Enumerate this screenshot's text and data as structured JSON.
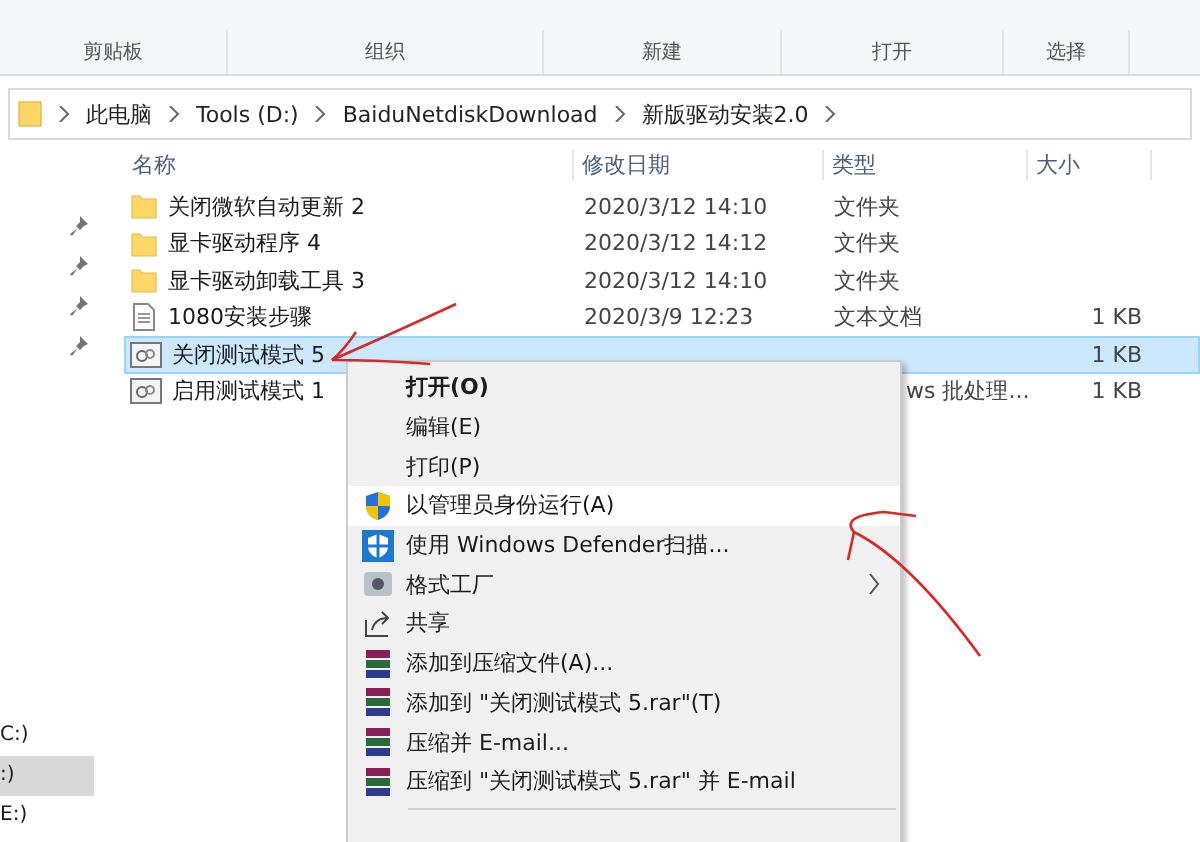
{
  "ribbon": {
    "groups": [
      "剪贴板",
      "组织",
      "新建",
      "打开",
      "选择"
    ]
  },
  "address_bar": {
    "crumbs": [
      "此电脑",
      "Tools (D:)",
      "BaiduNetdiskDownload",
      "新版驱动安装2.0"
    ]
  },
  "nav_pane": {
    "drives": [
      {
        "label": "C:)",
        "selected": false
      },
      {
        "label": ":)",
        "selected": true
      },
      {
        "label": "E:)",
        "selected": false
      }
    ]
  },
  "file_list": {
    "columns": [
      "名称",
      "修改日期",
      "类型",
      "大小"
    ],
    "rows": [
      {
        "kind": "folder",
        "name": "关闭微软自动更新 2",
        "date": "2020/3/12 14:10",
        "type": "文件夹",
        "selected": false
      },
      {
        "kind": "folder",
        "name": "显卡驱动程序 4",
        "date": "2020/3/12 14:12",
        "type": "文件夹",
        "selected": false
      },
      {
        "kind": "folder",
        "name": "显卡驱动卸载工具 3",
        "date": "2020/3/12 14:10",
        "type": "文件夹",
        "selected": false
      },
      {
        "kind": "text",
        "name": "1080安装步骤",
        "date": "2020/3/9 12:23",
        "type": "文本文档",
        "size": "1 KB",
        "selected": false
      },
      {
        "kind": "batch",
        "name": "关闭测试模式 5",
        "size": "1 KB",
        "selected": true
      },
      {
        "kind": "batch",
        "name": "启用测试模式 1",
        "type": "ws 批处理...",
        "size": "1 KB",
        "selected": false
      }
    ]
  },
  "context_menu": {
    "items": [
      {
        "kind": "plain",
        "label": "打开(O)",
        "default": true,
        "selected": false,
        "submenu": false
      },
      {
        "kind": "plain",
        "label": "编辑(E)",
        "default": false,
        "selected": false,
        "submenu": false
      },
      {
        "kind": "plain",
        "label": "打印(P)",
        "default": false,
        "selected": false,
        "submenu": false
      },
      {
        "kind": "uac",
        "label": "以管理员身份运行(A)",
        "default": false,
        "selected": true,
        "submenu": false
      },
      {
        "kind": "defender",
        "label": "使用 Windows Defender扫描...",
        "default": false,
        "selected": false,
        "submenu": false
      },
      {
        "kind": "app",
        "label": "格式工厂",
        "default": false,
        "selected": false,
        "submenu": true
      },
      {
        "kind": "share",
        "label": "共享",
        "default": false,
        "selected": false,
        "submenu": false
      },
      {
        "kind": "archive",
        "label": "添加到压缩文件(A)...",
        "default": false,
        "selected": false,
        "submenu": false
      },
      {
        "kind": "archive",
        "label": "添加到 \"关闭测试模式 5.rar\"(T)",
        "default": false,
        "selected": false,
        "submenu": false
      },
      {
        "kind": "archive",
        "label": "压缩并 E-mail...",
        "default": false,
        "selected": false,
        "submenu": false
      },
      {
        "kind": "archive",
        "label": "压缩到 \"关闭测试模式 5.rar\" 并 E-mail",
        "default": false,
        "selected": false,
        "submenu": false
      },
      {
        "kind": "separator"
      }
    ]
  }
}
